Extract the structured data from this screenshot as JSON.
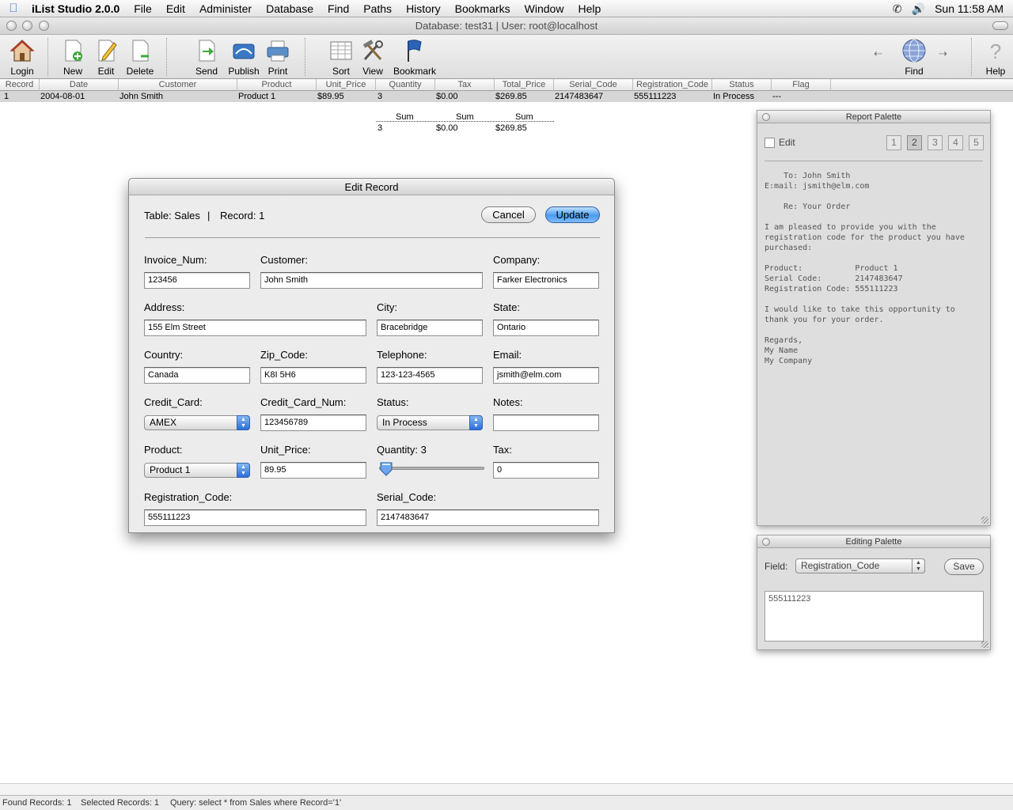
{
  "menubar": {
    "app_name": "iList Studio 2.0.0",
    "items": [
      "File",
      "Edit",
      "Administer",
      "Database",
      "Find",
      "Paths",
      "History",
      "Bookmarks",
      "Window",
      "Help"
    ],
    "clock": "Sun 11:58 AM"
  },
  "window": {
    "title": "Database: test31 | User: root@localhost"
  },
  "toolbar": {
    "login": "Login",
    "new": "New",
    "edit": "Edit",
    "delete": "Delete",
    "send": "Send",
    "publish": "Publish",
    "print": "Print",
    "sort": "Sort",
    "view": "View",
    "bookmark": "Bookmark",
    "find": "Find",
    "help": "Help"
  },
  "table": {
    "columns": [
      "Record",
      "Date",
      "Customer",
      "Product",
      "Unit_Price",
      "Quantity",
      "Tax",
      "Total_Price",
      "Serial_Code",
      "Registration_Code",
      "Status",
      "Flag"
    ],
    "row": [
      "1",
      "2004-08-01",
      "John Smith",
      "Product 1",
      "$89.95",
      "3",
      "$0.00",
      "$269.85",
      "2147483647",
      "555111223",
      "In Process",
      "---"
    ]
  },
  "summary": {
    "headers": [
      "Sum",
      "Sum",
      "Sum"
    ],
    "values": [
      "3",
      "$0.00",
      "$269.85"
    ]
  },
  "dialog": {
    "title": "Edit Record",
    "table_label": "Table: Sales",
    "divider": "|",
    "record_label": "Record: 1",
    "cancel": "Cancel",
    "update": "Update",
    "labels": {
      "invoice": "Invoice_Num:",
      "customer": "Customer:",
      "company": "Company:",
      "address": "Address:",
      "city": "City:",
      "state": "State:",
      "country": "Country:",
      "zip": "Zip_Code:",
      "telephone": "Telephone:",
      "email": "Email:",
      "credit_card": "Credit_Card:",
      "credit_card_num": "Credit_Card_Num:",
      "status": "Status:",
      "notes": "Notes:",
      "product": "Product:",
      "unit_price": "Unit_Price:",
      "quantity": "Quantity: 3",
      "tax": "Tax:",
      "registration": "Registration_Code:",
      "serial": "Serial_Code:"
    },
    "values": {
      "invoice": "123456",
      "customer": "John Smith",
      "company": "Farker Electronics",
      "address": "155 Elm Street",
      "city": "Bracebridge",
      "state": "Ontario",
      "country": "Canada",
      "zip": "K8I 5H6",
      "telephone": "123-123-4565",
      "email": "jsmith@elm.com",
      "credit_card": "AMEX",
      "credit_card_num": "123456789",
      "status": "In Process",
      "notes": "",
      "product": "Product 1",
      "unit_price": "89.95",
      "tax": "0",
      "registration": "555111223",
      "serial": "2147483647"
    },
    "quantity_value": 3
  },
  "report_palette": {
    "title": "Report Palette",
    "edit_label": "Edit",
    "pages": [
      "1",
      "2",
      "3",
      "4",
      "5"
    ],
    "selected_page": "2",
    "letter": "    To: John Smith\nE:mail: jsmith@elm.com\n\n    Re: Your Order\n\nI am pleased to provide you with the\nregistration code for the product you have\npurchased:\n\nProduct:           Product 1\nSerial Code:       2147483647\nRegistration Code: 555111223\n\nI would like to take this opportunity to\nthank you for your order.\n\nRegards,\nMy Name\nMy Company"
  },
  "editing_palette": {
    "title": "Editing Palette",
    "field_label": "Field:",
    "field_value": "Registration_Code",
    "save": "Save",
    "content": "555111223"
  },
  "statusbar": {
    "found": "Found Records: 1",
    "selected": "Selected Records: 1",
    "query": "Query: select * from Sales where Record='1'"
  }
}
